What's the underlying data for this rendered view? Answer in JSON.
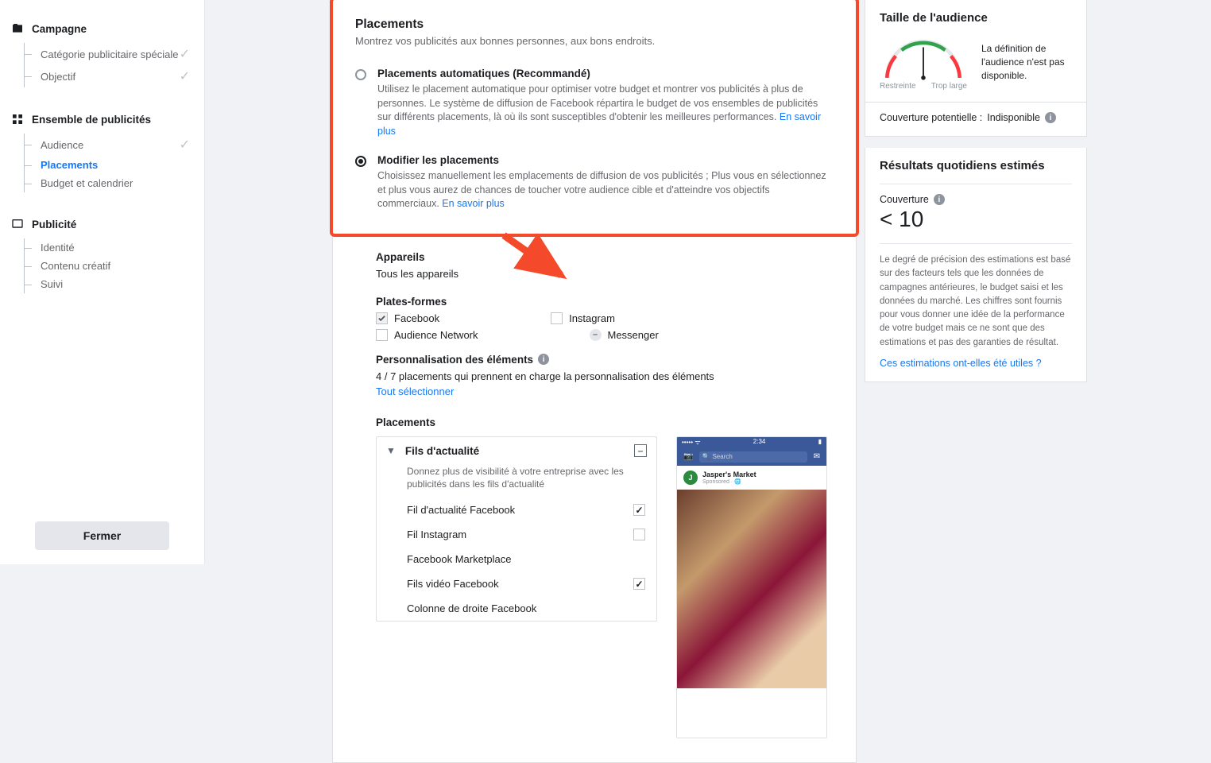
{
  "sidebar": {
    "groups": [
      {
        "label": "Campagne",
        "items": [
          {
            "label": "Catégorie publicitaire spéciale",
            "done": true
          },
          {
            "label": "Objectif",
            "done": true
          }
        ]
      },
      {
        "label": "Ensemble de publicités",
        "items": [
          {
            "label": "Audience",
            "done": true
          },
          {
            "label": "Placements",
            "current": true
          },
          {
            "label": "Budget et calendrier"
          }
        ]
      },
      {
        "label": "Publicité",
        "items": [
          {
            "label": "Identité"
          },
          {
            "label": "Contenu créatif"
          },
          {
            "label": "Suivi"
          }
        ]
      }
    ],
    "close": "Fermer"
  },
  "placements": {
    "title": "Placements",
    "subtitle": "Montrez vos publicités aux bonnes personnes, aux bons endroits.",
    "auto": {
      "label": "Placements automatiques (Recommandé)",
      "desc": "Utilisez le placement automatique pour optimiser votre budget et montrer vos publicités à plus de personnes. Le système de diffusion de Facebook répartira le budget de vos ensembles de publicités sur différents placements, là où ils sont susceptibles d'obtenir les meilleures performances.",
      "link": "En savoir plus"
    },
    "edit": {
      "label": "Modifier les placements",
      "desc": "Choisissez manuellement les emplacements de diffusion de vos publicités ; Plus vous en sélectionnez et plus vous aurez de chances de toucher votre audience cible et d'atteindre vos objectifs commerciaux.",
      "link": "En savoir plus"
    },
    "devices": {
      "title": "Appareils",
      "value": "Tous les appareils"
    },
    "platforms": {
      "title": "Plates-formes",
      "fb": "Facebook",
      "ig": "Instagram",
      "an": "Audience Network",
      "msg": "Messenger"
    },
    "perso": {
      "title": "Personnalisation des éléments",
      "count": "4 / 7 placements qui prennent en charge la personnalisation des éléments",
      "select_all": "Tout sélectionner"
    },
    "list": {
      "title": "Placements",
      "group": {
        "name": "Fils d'actualité",
        "desc": "Donnez plus de visibilité à votre entreprise avec les publicités dans les fils d'actualité"
      },
      "items": [
        {
          "label": "Fil d'actualité Facebook",
          "on": true
        },
        {
          "label": "Fil Instagram",
          "on": false
        },
        {
          "label": "Facebook Marketplace",
          "on": null
        },
        {
          "label": "Fils vidéo Facebook",
          "on": true
        },
        {
          "label": "Colonne de droite Facebook",
          "on": null
        }
      ]
    },
    "preview": {
      "time": "2:34",
      "search": "Search",
      "brand": "Jasper's Market",
      "sponsored": "Sponsored"
    }
  },
  "audience_size": {
    "title": "Taille de l'audience",
    "text": "La définition de l'audience n'est pas disponible.",
    "low": "Restreinte",
    "high": "Trop large",
    "coverage_label": "Couverture potentielle :",
    "coverage_value": "Indisponible"
  },
  "estimates": {
    "title": "Résultats quotidiens estimés",
    "cov_label": "Couverture",
    "cov_value": "< 10",
    "paragraph": "Le degré de précision des estimations est basé sur des facteurs tels que les données de campagnes antérieures, le budget saisi et les données du marché. Les chiffres sont fournis pour vous donner une idée de la performance de votre budget mais ce ne sont que des estimations et pas des garanties de résultat.",
    "feedback": "Ces estimations ont-elles été utiles ?"
  }
}
